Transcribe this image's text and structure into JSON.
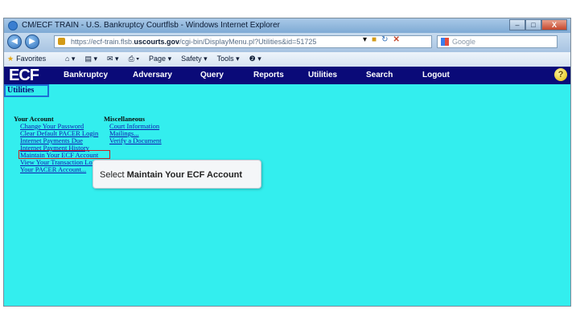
{
  "window": {
    "title": "CM/ECF TRAIN - U.S. Bankruptcy Courtflsb - Windows Internet Explorer",
    "buttons": [
      "–",
      "□",
      "X"
    ]
  },
  "address_bar": {
    "url_prefix": "https://ecf-train.flsb.",
    "url_domain": "uscourts.gov",
    "url_rest": "/cgi-bin/DisplayMenu.pl?Utilities&id=51725",
    "search_placeholder": "Google"
  },
  "command_bar": {
    "favorites": "Favorites",
    "items": [
      "Page ▾",
      "Safety ▾",
      "Tools ▾"
    ]
  },
  "ecf_menu": {
    "logo": "ECF",
    "items": [
      "Bankruptcy",
      "Adversary",
      "Query",
      "Reports",
      "Utilities",
      "Search",
      "Logout"
    ]
  },
  "breadcrumb": "Utilities",
  "your_account": {
    "heading": "Your Account",
    "links": [
      "Change Your Password",
      "Clear Default PACER Login",
      "Internet Payments Due",
      "Internet Payment History",
      "Maintain Your ECF Account",
      "View Your Transaction Lo",
      "Your PACER Account..."
    ]
  },
  "miscellaneous": {
    "heading": "Miscellaneous",
    "links": [
      "Court Information",
      "Mailings...",
      "Verify a Document"
    ]
  },
  "tooltip": {
    "prefix": "Select ",
    "emphasis": "Maintain Your ECF Account"
  },
  "colors": {
    "ecf_bar": "#0a0a78",
    "content_bg": "#33eeee",
    "highlight": "#cc1f1f"
  }
}
